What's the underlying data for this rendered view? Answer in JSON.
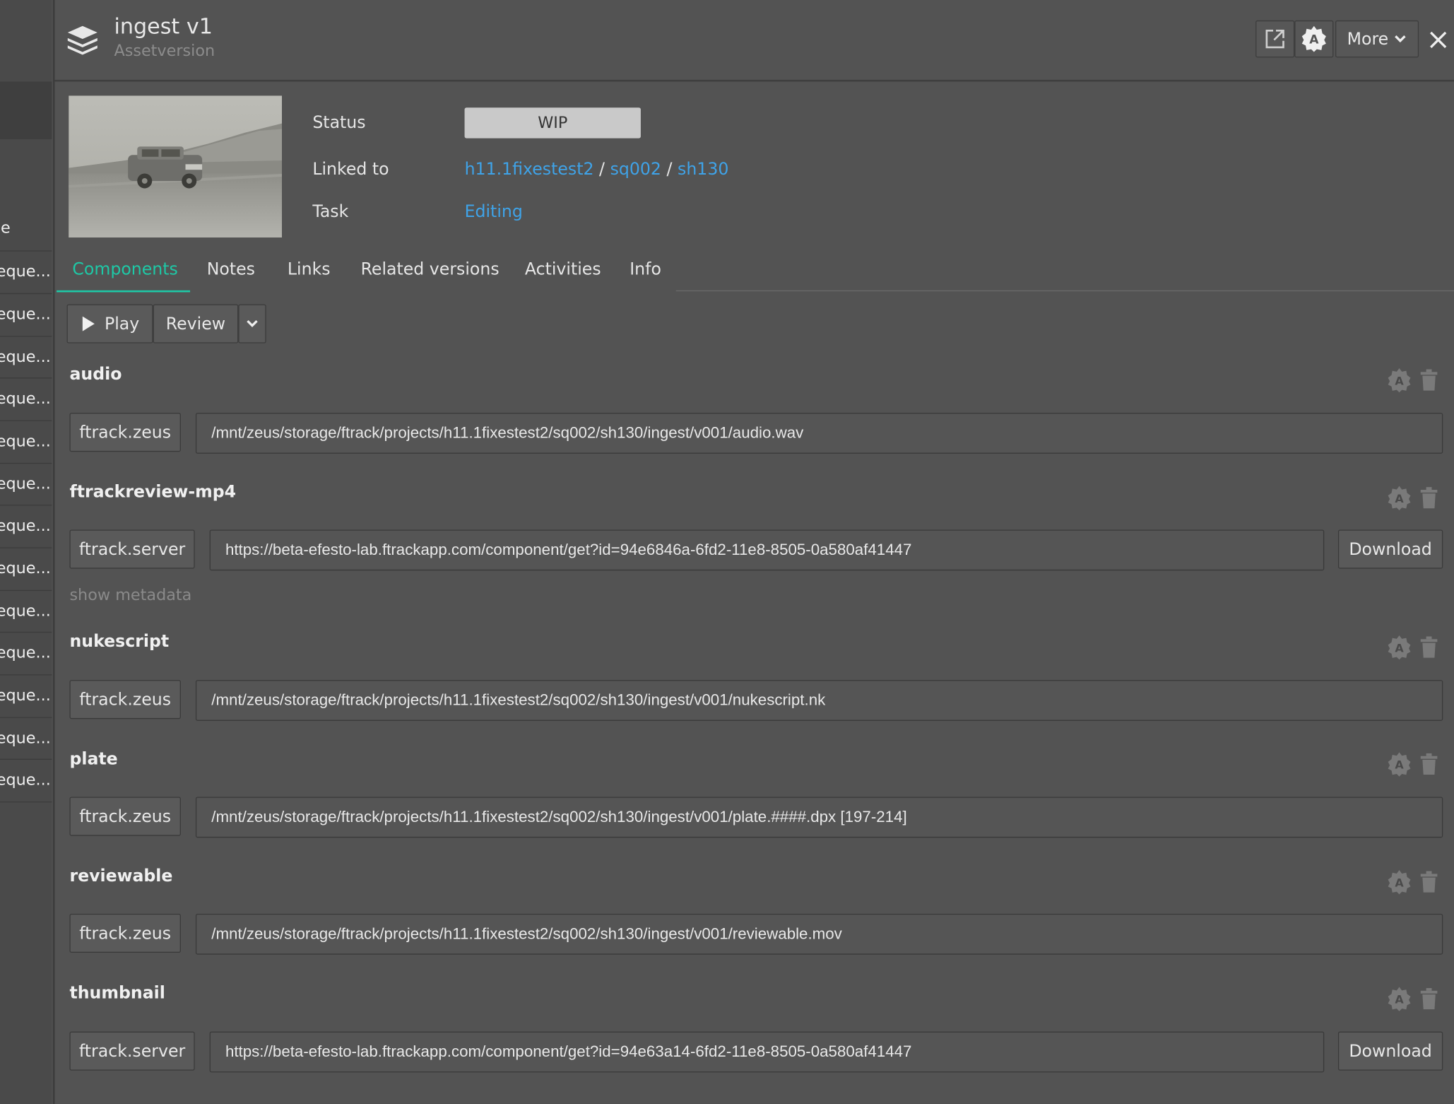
{
  "sidebar": {
    "header": "pe",
    "items": [
      "eque...",
      "eque...",
      "eque...",
      "eque...",
      "eque...",
      "eque...",
      "eque...",
      "eque...",
      "eque...",
      "eque...",
      "eque...",
      "eque...",
      "eque..."
    ]
  },
  "header": {
    "title": "ingest v1",
    "subtitle": "Assetversion",
    "more_label": "More"
  },
  "attributes": {
    "status_label": "Status",
    "status_value": "WIP",
    "linked_label": "Linked to",
    "linked_path": [
      "h11.1fixestest2",
      "sq002",
      "sh130"
    ],
    "separator": "/",
    "task_label": "Task",
    "task_value": "Editing"
  },
  "tabs": [
    "Components",
    "Notes",
    "Links",
    "Related versions",
    "Activities",
    "Info"
  ],
  "toolbar": {
    "play_label": "Play",
    "review_label": "Review"
  },
  "components": [
    {
      "name": "audio",
      "location": "ftrack.zeus",
      "path": "/mnt/zeus/storage/ftrack/projects/h11.1fixestest2/sq002/sh130/ingest/v001/audio.wav"
    },
    {
      "name": "ftrackreview-mp4",
      "location": "ftrack.server",
      "path": "https://beta-efesto-lab.ftrackapp.com/component/get?id=94e6846a-6fd2-11e8-8505-0a580af41447",
      "download": "Download",
      "meta": "show metadata"
    },
    {
      "name": "nukescript",
      "location": "ftrack.zeus",
      "path": "/mnt/zeus/storage/ftrack/projects/h11.1fixestest2/sq002/sh130/ingest/v001/nukescript.nk"
    },
    {
      "name": "plate",
      "location": "ftrack.zeus",
      "path": "/mnt/zeus/storage/ftrack/projects/h11.1fixestest2/sq002/sh130/ingest/v001/plate.####.dpx [197-214]"
    },
    {
      "name": "reviewable",
      "location": "ftrack.zeus",
      "path": "/mnt/zeus/storage/ftrack/projects/h11.1fixestest2/sq002/sh130/ingest/v001/reviewable.mov"
    },
    {
      "name": "thumbnail",
      "location": "ftrack.server",
      "path": "https://beta-efesto-lab.ftrackapp.com/component/get?id=94e63a14-6fd2-11e8-8505-0a580af41447",
      "download": "Download"
    }
  ],
  "colors": {
    "accent": "#1ec8a6",
    "link": "#3fa3e8",
    "background": "#535353"
  }
}
